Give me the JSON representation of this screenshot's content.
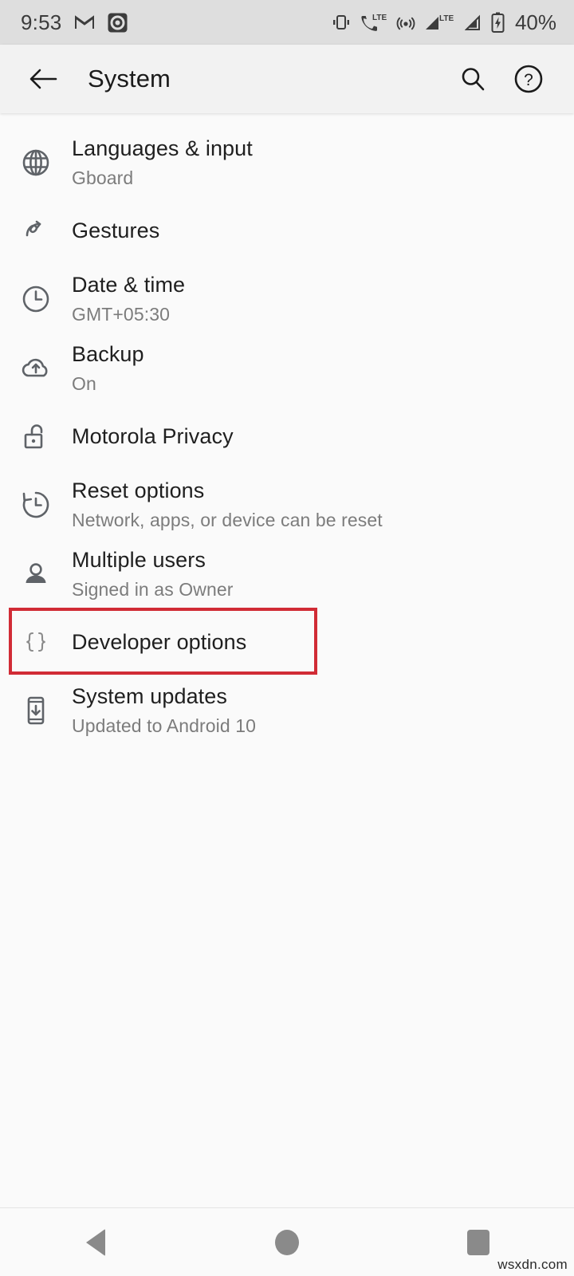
{
  "status_bar": {
    "time": "9:53",
    "battery_percent": "40%",
    "left_icons": [
      "gmail-icon",
      "screen-record-icon"
    ],
    "right_icons": [
      "vibrate-icon",
      "call-lte-icon",
      "hotspot-icon",
      "signal-lte-icon",
      "signal-icon",
      "battery-charging-icon"
    ],
    "background": "#DEDEDE"
  },
  "app_bar": {
    "title": "System",
    "back_label": "Back",
    "search_label": "Search",
    "help_label": "Help",
    "background": "#F2F2F2"
  },
  "list": {
    "items": [
      {
        "icon": "globe-icon",
        "title": "Languages & input",
        "subtitle": "Gboard"
      },
      {
        "icon": "gesture-icon",
        "title": "Gestures",
        "subtitle": ""
      },
      {
        "icon": "clock-icon",
        "title": "Date & time",
        "subtitle": "GMT+05:30"
      },
      {
        "icon": "cloud-upload-icon",
        "title": "Backup",
        "subtitle": "On"
      },
      {
        "icon": "unlock-icon",
        "title": "Motorola Privacy",
        "subtitle": ""
      },
      {
        "icon": "history-icon",
        "title": "Reset options",
        "subtitle": "Network, apps, or device can be reset"
      },
      {
        "icon": "person-icon",
        "title": "Multiple users",
        "subtitle": "Signed in as Owner"
      },
      {
        "icon": "braces-icon",
        "title": "Developer options",
        "subtitle": "",
        "highlighted": true
      },
      {
        "icon": "system-update-icon",
        "title": "System updates",
        "subtitle": "Updated to Android 10"
      }
    ],
    "highlight_color": "#D12B35",
    "background": "#FAFAFA"
  },
  "nav_bar": {
    "back_label": "Back",
    "home_label": "Home",
    "recents_label": "Recents"
  },
  "watermark": "wsxdn.com"
}
